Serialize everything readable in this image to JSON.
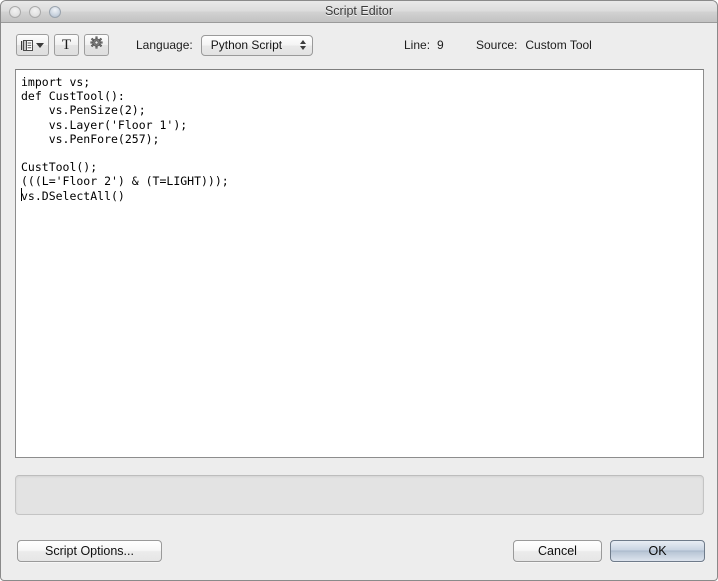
{
  "window": {
    "title": "Script Editor",
    "traffic_lights": [
      {
        "name": "close-button"
      },
      {
        "name": "minimize-button"
      },
      {
        "name": "zoom-button"
      }
    ]
  },
  "toolbar": {
    "buttons": [
      {
        "name": "list-view-button",
        "icon": "list-icon"
      },
      {
        "name": "text-format-button",
        "icon": "text-T-icon",
        "glyph": "T"
      },
      {
        "name": "settings-button",
        "icon": "gear-icon"
      }
    ],
    "language_label": "Language:",
    "language_value": "Python Script",
    "language_options": [
      "Python Script"
    ],
    "line_label": "Line:",
    "line_value": "9",
    "source_label": "Source:",
    "source_value": "Custom Tool"
  },
  "editor": {
    "code": "import vs;\ndef CustTool():\n    vs.PenSize(2);\n    vs.Layer('Floor 1');\n    vs.PenFore(257);\n\nCustTool();\n(((L='Floor 2') & (T=LIGHT)));\nvs.DSelectAll()",
    "caret_line": 9
  },
  "status_panel": {
    "text": ""
  },
  "footer": {
    "script_options_label": "Script Options...",
    "cancel_label": "Cancel",
    "ok_label": "OK"
  },
  "colors": {
    "window_bg": "#ededed",
    "editor_bg": "#ffffff",
    "default_button_accent": "#a9b8cb"
  }
}
